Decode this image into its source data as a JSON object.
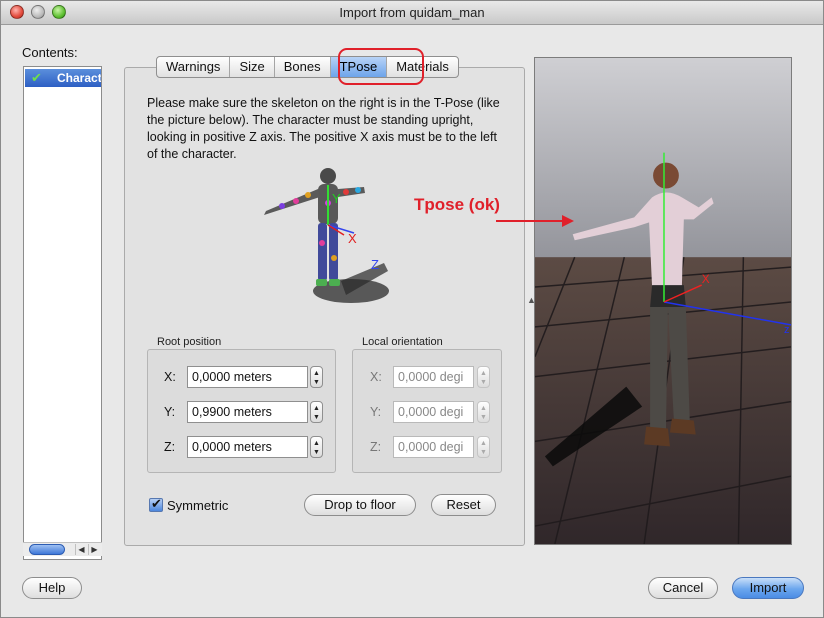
{
  "window": {
    "title": "Import from quidam_man"
  },
  "contents": {
    "label": "Contents:",
    "items": [
      {
        "label": "Charact",
        "status": "check-icon"
      }
    ]
  },
  "tabs": [
    {
      "label": "Warnings",
      "active": false
    },
    {
      "label": "Size",
      "active": false
    },
    {
      "label": "Bones",
      "active": false
    },
    {
      "label": "TPose",
      "active": true
    },
    {
      "label": "Materials",
      "active": false
    }
  ],
  "instructions": "Please make sure the skeleton on the right is in the T-Pose (like the picture below). The character must be standing upright, looking in positive Z axis. The positive X axis must be to the left of the character.",
  "figure": {
    "axis_y": "Y",
    "axis_x": "X",
    "axis_z": "Z"
  },
  "root_position": {
    "label": "Root position",
    "x_label": "X:",
    "x_value": "0,0000 meters",
    "y_label": "Y:",
    "y_value": "0,9900 meters",
    "z_label": "Z:",
    "z_value": "0,0000 meters"
  },
  "local_orientation": {
    "label": "Local orientation",
    "x_label": "X:",
    "x_value": "0,0000 degi",
    "y_label": "Y:",
    "y_value": "0,0000 degi",
    "z_label": "Z:",
    "z_value": "0,0000 degi"
  },
  "options": {
    "symmetric_label": "Symmetric",
    "symmetric_checked": true,
    "drop_to_floor": "Drop to floor",
    "reset": "Reset"
  },
  "viewport": {
    "axis_x": "X",
    "axis_z": "z"
  },
  "annotation": {
    "text": "Tpose (ok)",
    "color": "#e0202a"
  },
  "footer": {
    "help": "Help",
    "cancel": "Cancel",
    "import": "Import"
  }
}
